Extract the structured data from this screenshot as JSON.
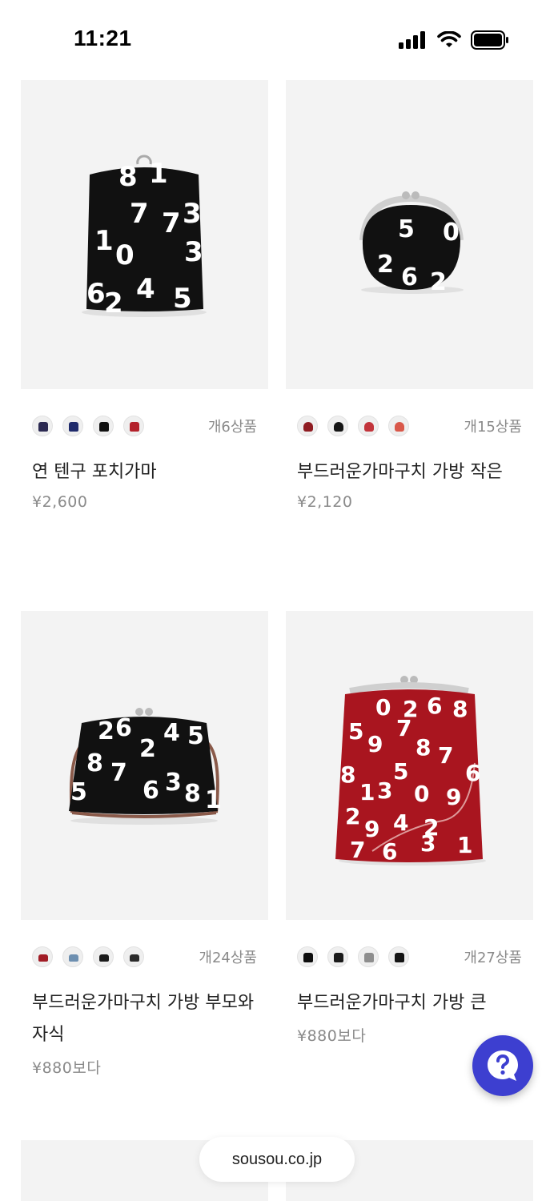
{
  "status_bar": {
    "time": "11:21"
  },
  "products": [
    {
      "name": "연 텐구 포치가마",
      "price": "¥2,600",
      "count": "개6상품",
      "swatches": [
        {
          "icon": "navy-pouch-swatch",
          "color": "#2c2a52"
        },
        {
          "icon": "navy-pattern-swatch",
          "color": "#1f2a6b"
        },
        {
          "icon": "black-numbers-swatch",
          "color": "#111111"
        },
        {
          "icon": "red-numbers-swatch",
          "color": "#b3212b"
        }
      ]
    },
    {
      "name": "부드러운가마구치 가방 작은",
      "price": "¥2,120",
      "count": "개15상품",
      "swatches": [
        {
          "icon": "red-purse-swatch",
          "color": "#8f1c22"
        },
        {
          "icon": "black-purse-swatch",
          "color": "#151515"
        },
        {
          "icon": "pink-purse-swatch",
          "color": "#c2343b"
        },
        {
          "icon": "multicolor-purse-swatch",
          "color": "#d9584a"
        }
      ]
    },
    {
      "name": "부드러운가마구치 가방 부모와 자식",
      "price": "¥880보다",
      "count": "개24상품",
      "swatches": [
        {
          "icon": "red-bag-swatch",
          "color": "#a11c25"
        },
        {
          "icon": "colorful-bag-swatch",
          "color": "#6d8fb0"
        },
        {
          "icon": "black-bag-swatch",
          "color": "#1b1b1b"
        },
        {
          "icon": "black-white-bag-swatch",
          "color": "#2a2a2a"
        }
      ]
    },
    {
      "name": "부드러운가마구치 가방 큰",
      "price": "¥880보다",
      "count": "개27상품",
      "swatches": [
        {
          "icon": "black-plain-swatch",
          "color": "#0d0d0d"
        },
        {
          "icon": "black-dots-swatch",
          "color": "#1a1a1a"
        },
        {
          "icon": "grey-bag-swatch",
          "color": "#8e8e8e"
        },
        {
          "icon": "black-pattern-swatch",
          "color": "#141414"
        }
      ]
    }
  ],
  "browser": {
    "url": "sousou.co.jp"
  },
  "colors": {
    "accent": "#3d3fd0",
    "muted_text": "#8a8a8a",
    "image_bg": "#f3f3f3"
  }
}
